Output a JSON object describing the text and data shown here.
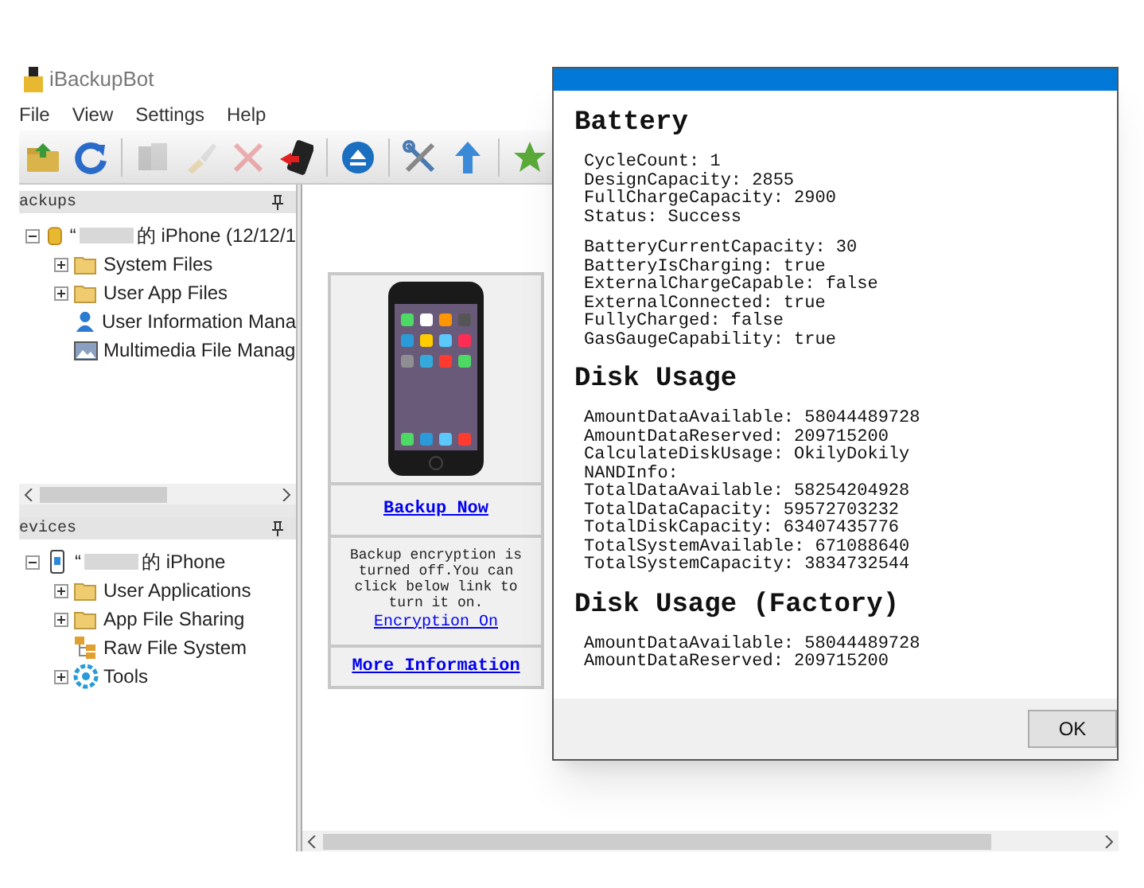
{
  "app": {
    "title": "iBackupBot"
  },
  "menu": [
    "File",
    "View",
    "Settings",
    "Help"
  ],
  "toolbar": [
    {
      "kind": "open-folder",
      "disabled": false
    },
    {
      "kind": "refresh",
      "disabled": false
    },
    {
      "kind": "sep"
    },
    {
      "kind": "copy",
      "disabled": true
    },
    {
      "kind": "brush",
      "disabled": true
    },
    {
      "kind": "delete",
      "disabled": true
    },
    {
      "kind": "phone-transfer",
      "disabled": false
    },
    {
      "kind": "sep"
    },
    {
      "kind": "eject",
      "disabled": false
    },
    {
      "kind": "sep"
    },
    {
      "kind": "tools",
      "disabled": false
    },
    {
      "kind": "upload",
      "disabled": false
    },
    {
      "kind": "sep"
    },
    {
      "kind": "star",
      "disabled": false
    }
  ],
  "backups": {
    "header": "ackups",
    "tree": [
      {
        "label": "“",
        "label_rest": "的 iPhone (12/12/1",
        "kind": "database",
        "expanded": true,
        "redacted": true,
        "children": [
          {
            "label": "System Files",
            "kind": "folder",
            "expanded": false
          },
          {
            "label": "User App Files",
            "kind": "folder",
            "expanded": false
          },
          {
            "label": "User Information Mana",
            "kind": "user"
          },
          {
            "label": "Multimedia File Manag",
            "kind": "media"
          }
        ]
      }
    ]
  },
  "devices": {
    "header": "evices",
    "tree": [
      {
        "label": "“",
        "label_rest": "的 iPhone",
        "kind": "phone",
        "expanded": true,
        "redacted": true,
        "children": [
          {
            "label": "User Applications",
            "kind": "folder",
            "expanded": false
          },
          {
            "label": "App File Sharing",
            "kind": "folder",
            "expanded": false
          },
          {
            "label": "Raw File System",
            "kind": "raw"
          },
          {
            "label": "Tools",
            "kind": "gear",
            "expanded": false
          }
        ]
      }
    ]
  },
  "card": {
    "backup_link": "Backup Now",
    "encryption_text": "Backup encryption is turned off.You can click below link to turn it on.",
    "encryption_link": "Encryption On",
    "more_link": "More Information"
  },
  "dialog": {
    "sections": [
      {
        "heading": "Battery",
        "groups": [
          [
            "CycleCount: 1",
            "DesignCapacity: 2855",
            "FullChargeCapacity: 2900",
            "Status: Success"
          ],
          [
            "BatteryCurrentCapacity: 30",
            "BatteryIsCharging: true",
            "ExternalChargeCapable: false",
            "ExternalConnected: true",
            "FullyCharged: false",
            "GasGaugeCapability: true"
          ]
        ]
      },
      {
        "heading": "Disk Usage",
        "groups": [
          [
            "AmountDataAvailable: 58044489728",
            "AmountDataReserved: 209715200",
            "CalculateDiskUsage: OkilyDokily",
            "NANDInfo:",
            "TotalDataAvailable: 58254204928",
            "TotalDataCapacity: 59572703232",
            "TotalDiskCapacity: 63407435776",
            "TotalSystemAvailable: 671088640",
            "TotalSystemCapacity: 3834732544"
          ]
        ]
      },
      {
        "heading": "Disk Usage (Factory)",
        "groups": [
          [
            "AmountDataAvailable: 58044489728",
            "AmountDataReserved: 209715200"
          ]
        ]
      }
    ],
    "ok": "OK"
  }
}
